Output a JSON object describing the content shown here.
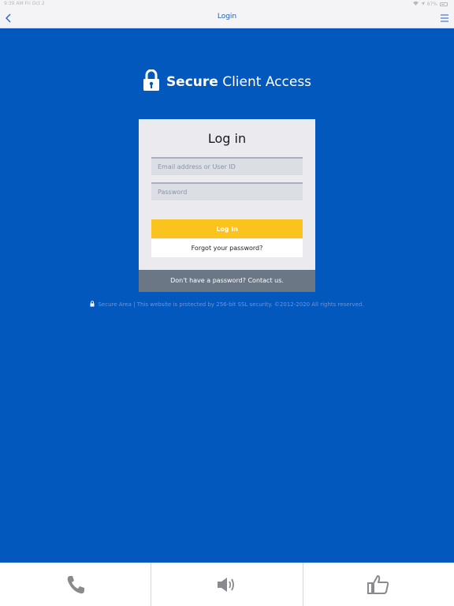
{
  "status_bar": {
    "time": "9:39 AM",
    "date": "Fri Oct 2",
    "battery": "87%"
  },
  "nav": {
    "title": "Login"
  },
  "brand": {
    "bold": "Secure",
    "light": "Client Access"
  },
  "login": {
    "heading": "Log in",
    "email_placeholder": "Email address or User ID",
    "password_placeholder": "Password",
    "button_label": "Log in",
    "forgot_label": "Forgot your password?",
    "contact_label": "Don't have a password? Contact us."
  },
  "footer_note": {
    "text": "Secure Area | This website is protected by 256-bit SSL security. ©2012-2020 All rights reserved."
  },
  "bottom_bar": {
    "items": [
      {
        "icon": "phone-icon"
      },
      {
        "icon": "speaker-icon"
      },
      {
        "icon": "thumbs-up-icon"
      }
    ]
  },
  "colors": {
    "background": "#0258bd",
    "button": "#fbc31e",
    "card": "#ebebef",
    "footer": "#6c7786",
    "nav_title": "#1d5fbf"
  }
}
